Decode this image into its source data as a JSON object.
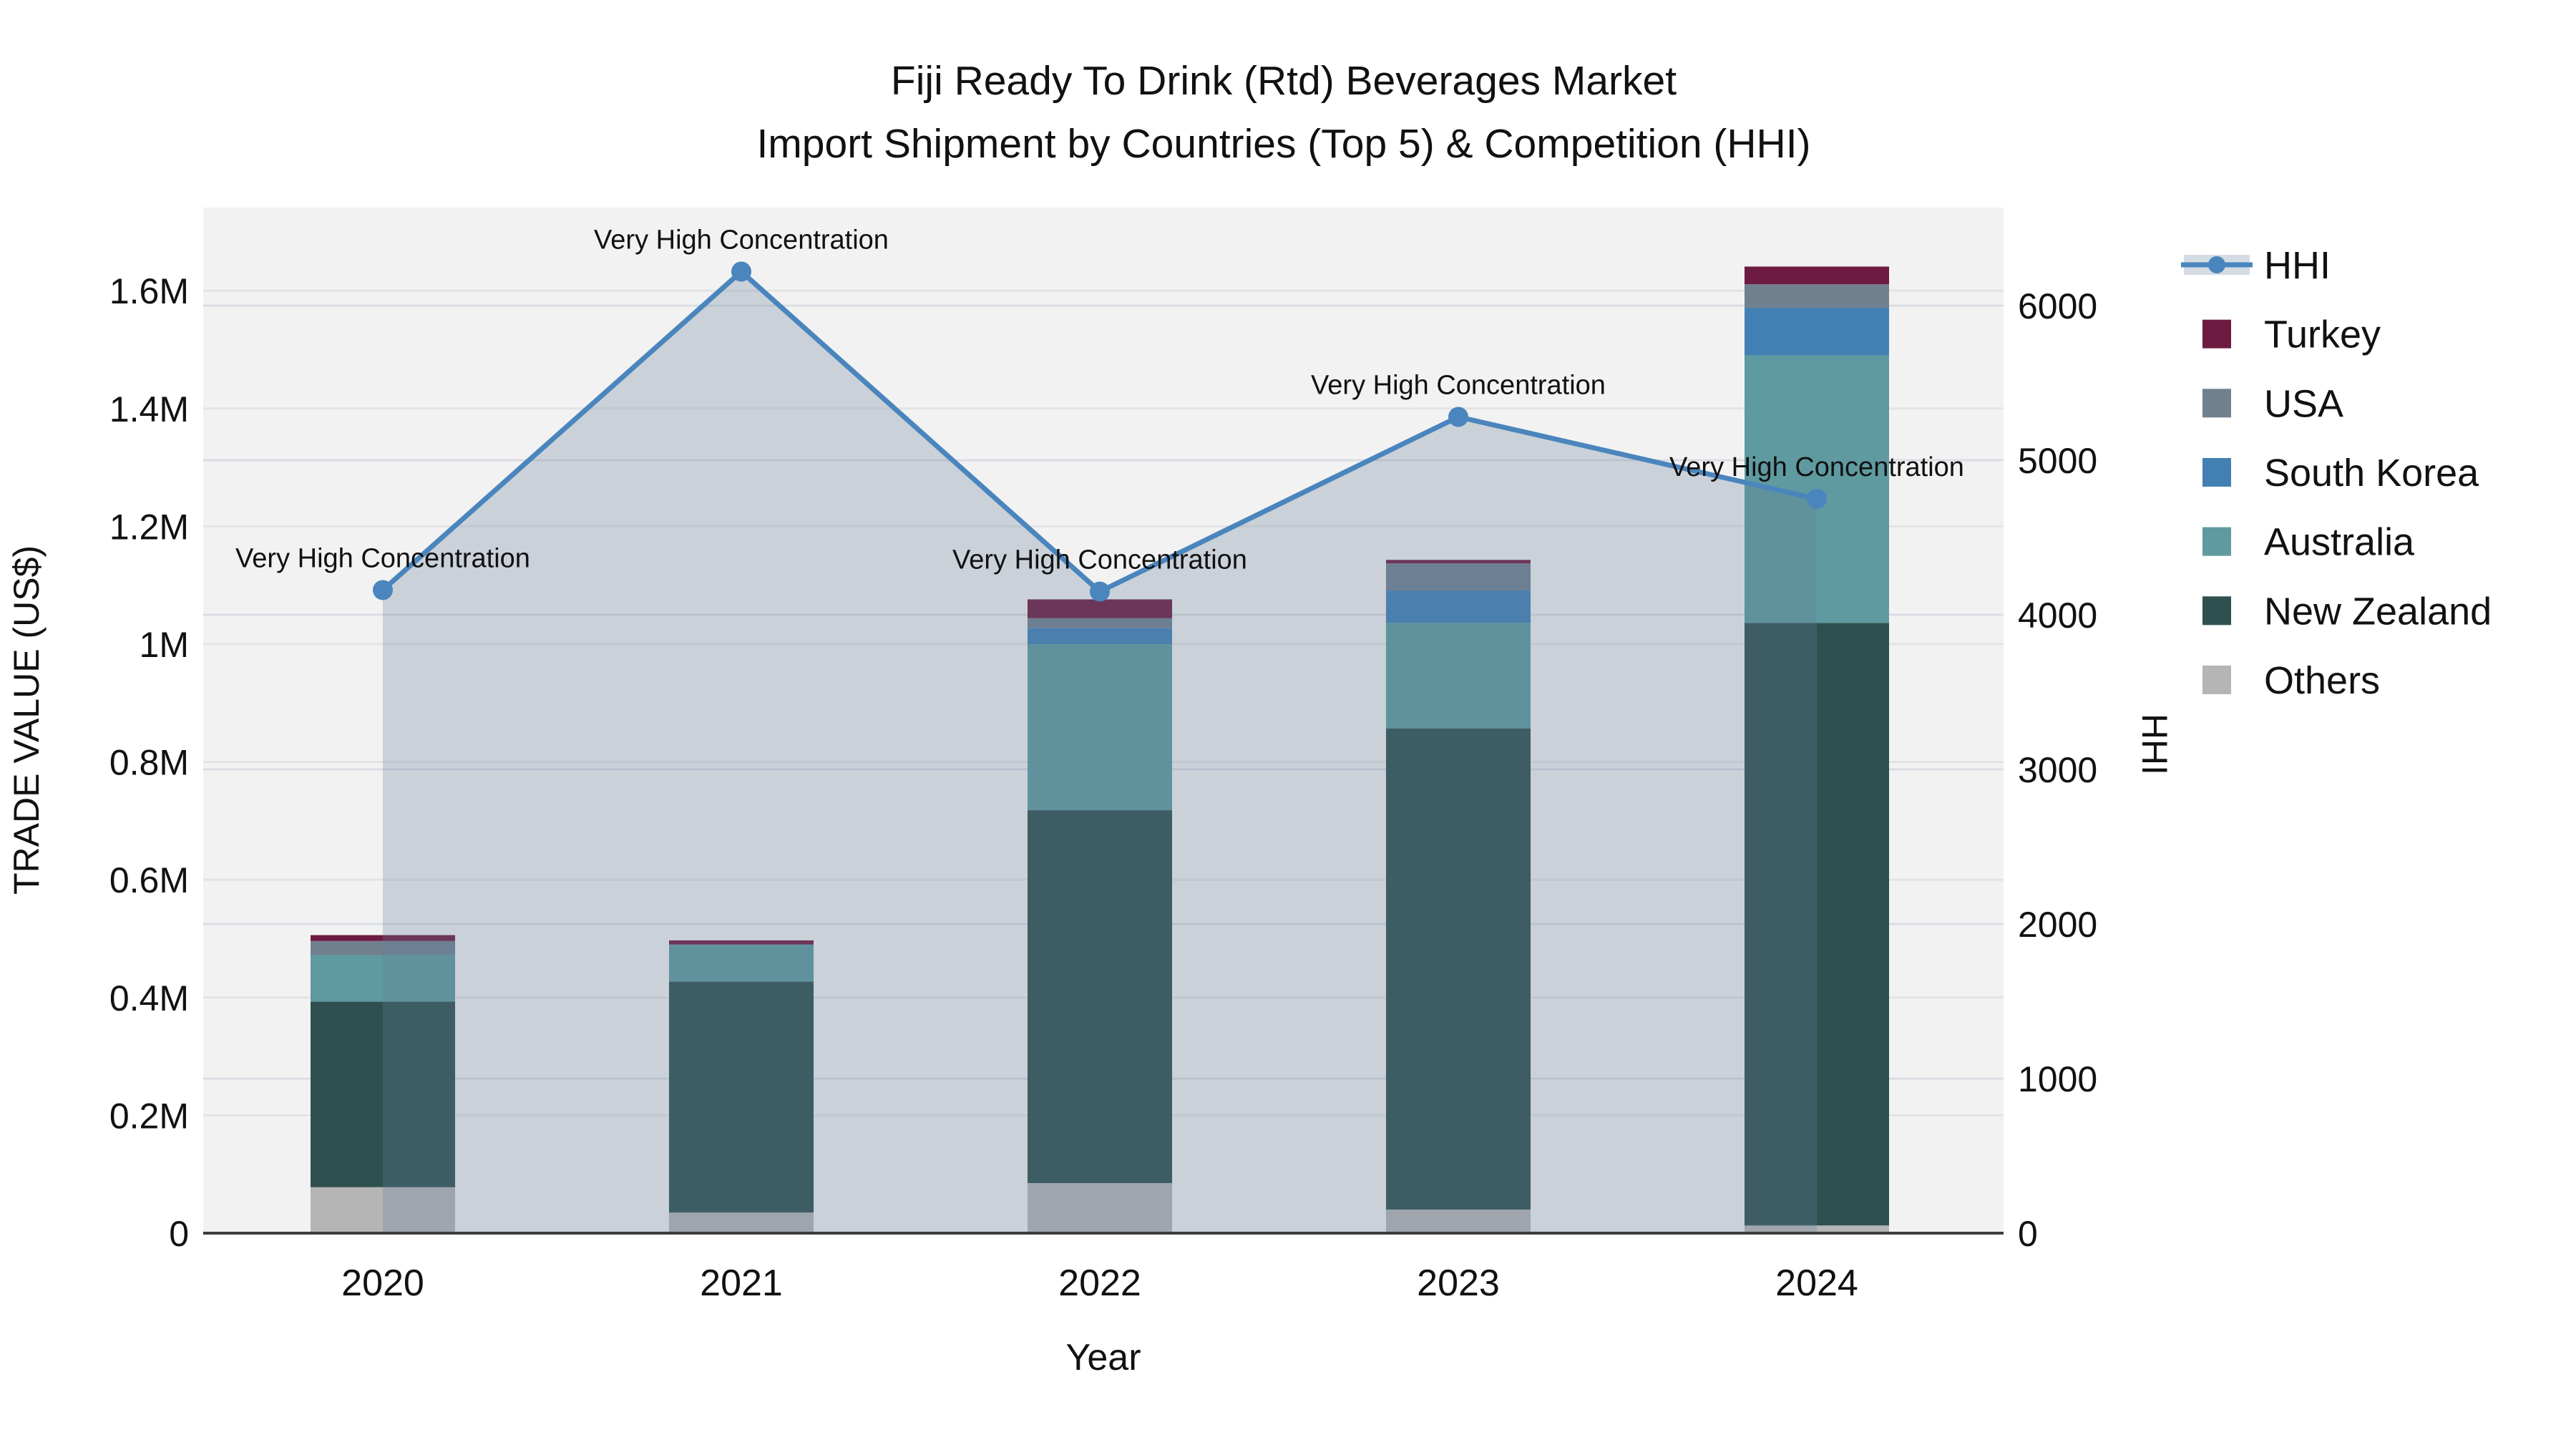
{
  "title": {
    "line1": "Fiji Ready To Drink (Rtd) Beverages Market",
    "line2": "Import Shipment by Countries (Top 5) & Competition (HHI)"
  },
  "chart_data": {
    "type": "combo-stacked-bar-line",
    "categories": [
      "2020",
      "2021",
      "2022",
      "2023",
      "2024"
    ],
    "x_axis": {
      "title": "Year"
    },
    "y_left": {
      "title": "TRADE VALUE (US$)",
      "tick_values": [
        0,
        200000,
        400000,
        600000,
        800000,
        1000000,
        1200000,
        1400000,
        1600000
      ],
      "tick_labels": [
        "0",
        "0.2M",
        "0.4M",
        "0.6M",
        "0.8M",
        "1M",
        "1.2M",
        "1.4M",
        "1.6M"
      ],
      "range": [
        0,
        1742000
      ]
    },
    "y_right": {
      "title": "HHI",
      "tick_values": [
        0,
        1000,
        2000,
        3000,
        4000,
        5000,
        6000
      ],
      "tick_labels": [
        "0",
        "1000",
        "2000",
        "3000",
        "4000",
        "5000",
        "6000"
      ],
      "range": [
        0,
        6634
      ]
    },
    "bar_series": [
      {
        "name": "Others",
        "color": "#b5b5b5",
        "values": [
          78000,
          35000,
          85000,
          40000,
          13000
        ]
      },
      {
        "name": "New Zealand",
        "color": "#305050",
        "values": [
          315000,
          392000,
          633000,
          817000,
          1023000
        ]
      },
      {
        "name": "Australia",
        "color": "#5f9aa0",
        "values": [
          79000,
          63000,
          282000,
          179000,
          454000
        ]
      },
      {
        "name": "South Korea",
        "color": "#4280b4",
        "values": [
          0,
          0,
          27000,
          55000,
          81000
        ]
      },
      {
        "name": "USA",
        "color": "#71808f",
        "values": [
          24000,
          0,
          17000,
          46000,
          40000
        ]
      },
      {
        "name": "Turkey",
        "color": "#6e1b41",
        "values": [
          10000,
          7000,
          32000,
          6000,
          30000
        ]
      }
    ],
    "line_series": {
      "name": "HHI",
      "color": "#4a85bd",
      "fill_color": "rgba(99,124,154,0.28)",
      "values": [
        4160,
        6220,
        4150,
        5280,
        4750
      ]
    },
    "annotations": [
      {
        "year": "2020",
        "text": "Very High Concentration"
      },
      {
        "year": "2021",
        "text": "Very High Concentration"
      },
      {
        "year": "2022",
        "text": "Very High Concentration"
      },
      {
        "year": "2023",
        "text": "Very High Concentration"
      },
      {
        "year": "2024",
        "text": "Very High Concentration"
      }
    ],
    "legend": [
      {
        "label": "HHI",
        "type": "line"
      },
      {
        "label": "Turkey",
        "type": "swatch",
        "color": "#6e1b41"
      },
      {
        "label": "USA",
        "type": "swatch",
        "color": "#71808f"
      },
      {
        "label": "South Korea",
        "type": "swatch",
        "color": "#4280b4"
      },
      {
        "label": "Australia",
        "type": "swatch",
        "color": "#5f9aa0"
      },
      {
        "label": "New Zealand",
        "type": "swatch",
        "color": "#305050"
      },
      {
        "label": "Others",
        "type": "swatch",
        "color": "#b5b5b5"
      }
    ],
    "style": {
      "plot_bg": "#f2f2f2",
      "grid_left": "#e3e3e3",
      "grid_right": "#d8dce2",
      "baseline": "#3d3d3d"
    }
  }
}
